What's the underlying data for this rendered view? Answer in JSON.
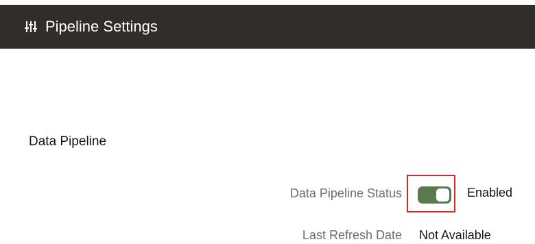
{
  "header": {
    "icon": "sliders-icon",
    "title": "Pipeline Settings"
  },
  "section": {
    "title": "Data Pipeline"
  },
  "fields": {
    "status": {
      "label": "Data Pipeline Status",
      "toggle_on": true,
      "value": "Enabled"
    },
    "last_refresh": {
      "label": "Last Refresh Date",
      "value": "Not Available"
    }
  },
  "colors": {
    "header_bg": "#312d2a",
    "toggle_on": "#5a7a4d",
    "highlight_border": "#d9262b"
  }
}
